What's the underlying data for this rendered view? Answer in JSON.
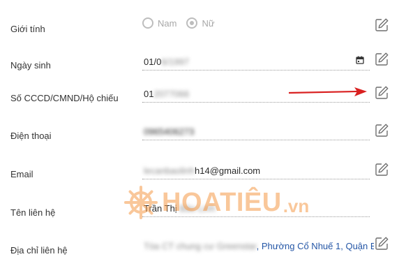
{
  "form": {
    "gender": {
      "label": "Giới tính",
      "options": [
        "Nam",
        "Nữ"
      ],
      "selected": "Nữ"
    },
    "birthday": {
      "label": "Ngày sinh",
      "value_visible": "01/0",
      "value_blurred": "6/1997"
    },
    "id_number": {
      "label": "Số CCCD/CMND/Hộ chiếu",
      "value_visible": "01",
      "value_blurred": "2077066"
    },
    "phone": {
      "label": "Điện thoại",
      "value_blurred": "0965406273"
    },
    "email": {
      "label": "Email",
      "value_blurred": "lecanbaolinh",
      "value_visible": "h14@gmail.com"
    },
    "contact_name": {
      "label": "Tên liên hệ",
      "value_visible": "Trần Thị",
      "value_blurred": "Bảo Linh"
    },
    "contact_address": {
      "label": "Địa chỉ liên hệ",
      "value_blurred": "Tòa CT chung cư Greenstar",
      "value_visible": ", Phường Cổ Nhuế 1, Quận B"
    }
  },
  "watermark": {
    "text": "HOATIÊU",
    "suffix": ".vn"
  },
  "colors": {
    "arrow": "#d92020",
    "watermark": "#f59a48",
    "link": "#2456a6"
  },
  "icons": {
    "edit": "pencil-square-icon",
    "calendar": "calendar-icon",
    "logo": "ship-wheel-icon"
  }
}
